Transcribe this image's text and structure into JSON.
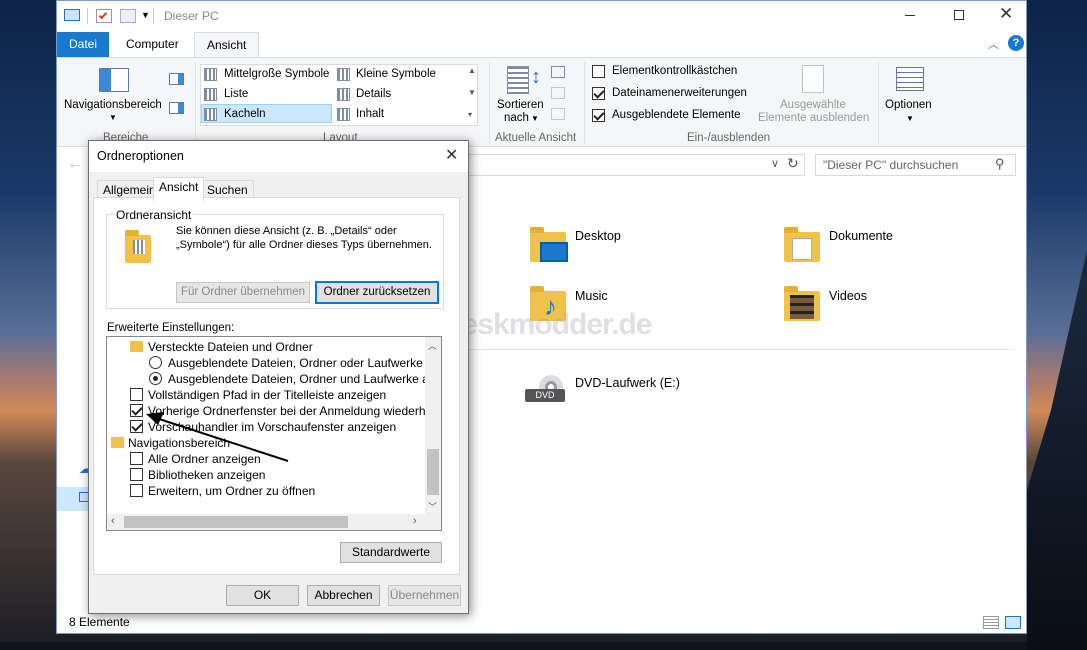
{
  "window": {
    "title": "Dieser PC"
  },
  "ribbon_tabs": [
    "Datei",
    "Computer",
    "Ansicht"
  ],
  "ribbon": {
    "nav_pane_label": "Navigationsbereich",
    "panes_group": "Bereiche",
    "layout_items": [
      "Mittelgroße Symbole",
      "Kleine Symbole",
      "Liste",
      "Details",
      "Kacheln",
      "Inhalt"
    ],
    "layout_group": "Layout",
    "sort_label": "Sortieren",
    "sort_sub": "nach",
    "current_view_group": "Aktuelle Ansicht",
    "show_hide_checks": [
      {
        "label": "Elementkontrollkästchen",
        "checked": false
      },
      {
        "label": "Dateinamenerweiterungen",
        "checked": true
      },
      {
        "label": "Ausgeblendete Elemente",
        "checked": true
      }
    ],
    "hide_selected_line1": "Ausgewählte",
    "hide_selected_line2": "Elemente ausblenden",
    "show_hide_group": "Ein-/ausblenden",
    "options_label": "Optionen"
  },
  "search": {
    "placeholder": "\"Dieser PC\" durchsuchen"
  },
  "content": {
    "items": [
      "Desktop",
      "Dokumente",
      "Music",
      "Videos"
    ],
    "dvd_label": "DVD-Laufwerk (E:)",
    "dvd_badge": "DVD",
    "watermark": "Deskmodder.de"
  },
  "status": {
    "text": "8 Elemente"
  },
  "dialog": {
    "title": "Ordneroptionen",
    "tabs": [
      "Allgemein",
      "Ansicht",
      "Suchen"
    ],
    "folder_view_title": "Ordneransicht",
    "folder_view_text1": "Sie können diese Ansicht (z. B. „Details“ oder",
    "folder_view_text2": "„Symbole“) für alle Ordner dieses Typs übernehmen.",
    "apply_btn": "Für Ordner übernehmen",
    "reset_btn": "Ordner zurücksetzen",
    "advanced_label": "Erweiterte Einstellungen:",
    "tree": [
      {
        "kind": "folder",
        "label": "Versteckte Dateien und Ordner"
      },
      {
        "kind": "radio",
        "checked": false,
        "label": "Ausgeblendete Dateien, Ordner oder Laufwerke nicht anzeigen"
      },
      {
        "kind": "radio",
        "checked": true,
        "label": "Ausgeblendete Dateien, Ordner und Laufwerke anzeigen"
      },
      {
        "kind": "check",
        "checked": false,
        "label": "Vollständigen Pfad in der Titelleiste anzeigen"
      },
      {
        "kind": "check",
        "checked": true,
        "label": "Vorherige Ordnerfenster bei der Anmeldung wiederherstellen"
      },
      {
        "kind": "check",
        "checked": true,
        "label": "Vorschauhandler im Vorschaufenster anzeigen"
      },
      {
        "kind": "navfolder",
        "label": "Navigationsbereich"
      },
      {
        "kind": "check",
        "checked": false,
        "label": "Alle Ordner anzeigen"
      },
      {
        "kind": "check",
        "checked": false,
        "label": "Bibliotheken anzeigen"
      },
      {
        "kind": "check",
        "checked": false,
        "label": "Erweitern, um Ordner zu öffnen"
      }
    ],
    "defaults_btn": "Standardwerte",
    "ok_btn": "OK",
    "cancel_btn": "Abbrechen",
    "apply_main_btn": "Übernehmen"
  }
}
